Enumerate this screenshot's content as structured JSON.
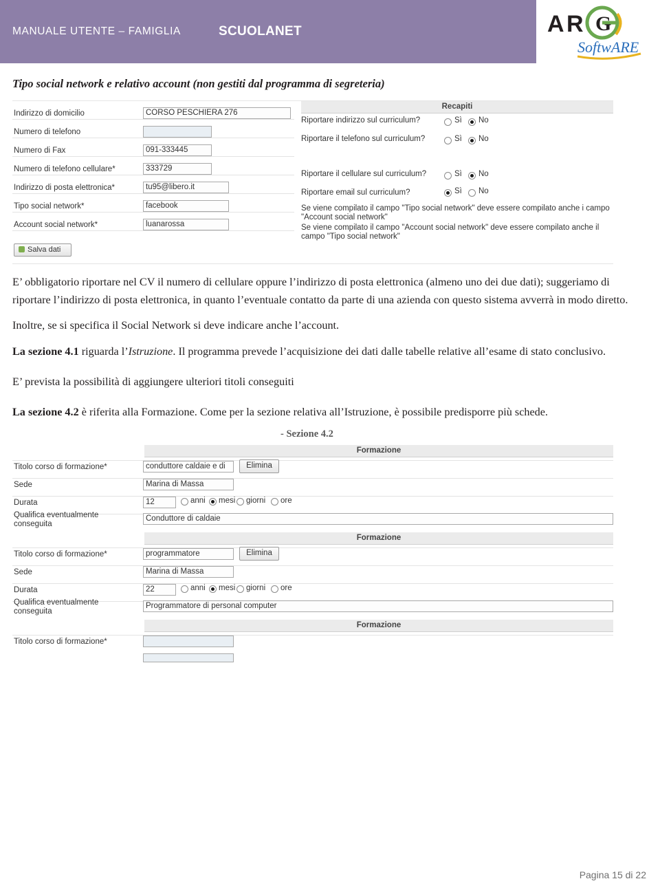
{
  "header": {
    "left_title": "MANUALE UTENTE – FAMIGLIA",
    "center_title": "SCUOLANET",
    "logo_line1": "ARGO",
    "logo_line2": "SoftwARE",
    "bg_color": "#8d7fa8"
  },
  "section_title": "Tipo social network e relativo account (non gestiti dal programma di segreteria)",
  "screenshot_recapiti": {
    "panel_title": "Recapiti",
    "left_fields": [
      {
        "label": "Indirizzo di domicilio",
        "value": "CORSO PESCHIERA 276"
      },
      {
        "label": "Numero di telefono",
        "value": ""
      },
      {
        "label": "Numero di Fax",
        "value": "091-333445"
      },
      {
        "label": "Numero di telefono cellulare*",
        "value": "333729"
      },
      {
        "label": "Indirizzo di posta elettronica*",
        "value": "tu95@libero.it"
      },
      {
        "label": "Tipo social network*",
        "value": "facebook"
      },
      {
        "label": "Account social network*",
        "value": "luanarossa"
      }
    ],
    "questions": [
      {
        "text": "Riportare indirizzo sul curriculum?",
        "si": "Sì",
        "no": "No",
        "selected": "No"
      },
      {
        "text": "Riportare il telefono sul curriculum?",
        "si": "Sì",
        "no": "No",
        "selected": "No"
      },
      {
        "text": "Riportare il cellulare sul curriculum?",
        "si": "Sì",
        "no": "No",
        "selected": "No"
      },
      {
        "text": "Riportare email sul curriculum?",
        "si": "Sì",
        "no": "No",
        "selected": "Sì"
      }
    ],
    "notes": [
      "Se viene compilato il campo \"Tipo social network\" deve essere compilato anche i campo \"Account social network\"",
      "Se viene compilato il campo \"Account social network\" deve essere compilato anche il campo \"Tipo social network\""
    ],
    "save_button": "Salva dati"
  },
  "paragraphs": {
    "p1_a": "E’ obbligatorio riportare nel CV il numero di cellulare oppure l’indirizzo di posta elettronica (almeno uno dei due dati); suggeriamo di riportare l’indirizzo di posta elettronica, in quanto l’eventuale contatto da parte di una azienda con questo sistema avverrà in modo diretto.",
    "p2": "Inoltre, se si specifica il Social Network si deve indicare anche l’account.",
    "p3_bold": "La sezione 4.1",
    "p3_mid": " riguarda l’",
    "p3_italic": "Istruzione",
    "p3_rest": ". Il programma prevede l’acquisizione dei dati dalle tabelle relative all’esame di stato conclusivo.",
    "p4": "E’ prevista la possibilità di aggiungere ulteriori titoli conseguiti",
    "p5_bold": "La sezione 4.2",
    "p5_rest": " è riferita alla Formazione. Come per la sezione relativa all’Istruzione, è possibile predisporre più schede."
  },
  "screenshot_formazione": {
    "caption": "- Sezione 4.2",
    "blocks": [
      {
        "panel_title": "Formazione",
        "fields": [
          {
            "label": "Titolo corso di formazione*",
            "value": "conduttore caldaie e di"
          },
          {
            "label": "Sede",
            "value": "Marina di Massa"
          },
          {
            "label": "Durata",
            "value": "12"
          }
        ],
        "duration_options": [
          {
            "label": "anni",
            "selected": false
          },
          {
            "label": "mesi",
            "selected": true
          },
          {
            "label": "giorni",
            "selected": false
          },
          {
            "label": "ore",
            "selected": false
          }
        ],
        "qualification_label": "Qualifica eventualmente conseguita",
        "qualification_value": "Conduttore di caldaie",
        "delete_button": "Elimina"
      },
      {
        "panel_title": "Formazione",
        "fields": [
          {
            "label": "Titolo corso di formazione*",
            "value": "programmatore"
          },
          {
            "label": "Sede",
            "value": "Marina di Massa"
          },
          {
            "label": "Durata",
            "value": "22"
          }
        ],
        "duration_options": [
          {
            "label": "anni",
            "selected": false
          },
          {
            "label": "mesi",
            "selected": true
          },
          {
            "label": "giorni",
            "selected": false
          },
          {
            "label": "ore",
            "selected": false
          }
        ],
        "qualification_label": "Qualifica eventualmente conseguita",
        "qualification_value": "Programmatore di personal computer",
        "delete_button": "Elimina"
      },
      {
        "panel_title": "Formazione",
        "fields": [
          {
            "label": "Titolo corso di formazione*",
            "value": ""
          }
        ]
      }
    ]
  },
  "footer": {
    "page_label": "Pagina 15 di 22"
  }
}
